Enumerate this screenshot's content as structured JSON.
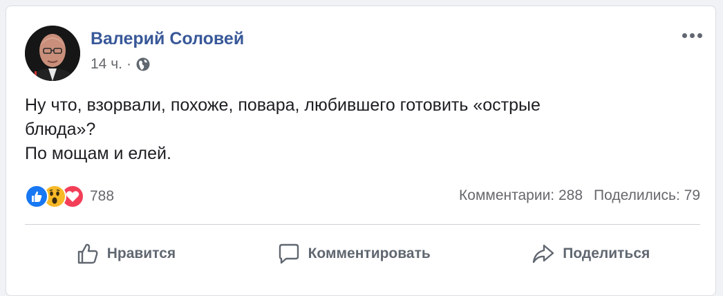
{
  "post": {
    "author": "Валерий Соловей",
    "time": "14 ч.",
    "separator": "·",
    "privacy_icon": "globe-icon",
    "text_lines": [
      "Ну что, взорвали, похоже, повара, любившего готовить «острые",
      "блюда»?",
      "По мощам и елей."
    ]
  },
  "reactions": {
    "icons": [
      "like-reaction-icon",
      "wow-reaction-icon",
      "love-reaction-icon"
    ],
    "count": "788"
  },
  "stats": {
    "comments": "Комментарии: 288",
    "shares": "Поделились: 79"
  },
  "actions": {
    "like": "Нравится",
    "comment": "Комментировать",
    "share": "Поделиться"
  },
  "colors": {
    "author": "#385898",
    "meta": "#65676b",
    "like_blue": "#1877f2",
    "wow_yellow": "#f7b928",
    "love_red": "#f33e58"
  }
}
